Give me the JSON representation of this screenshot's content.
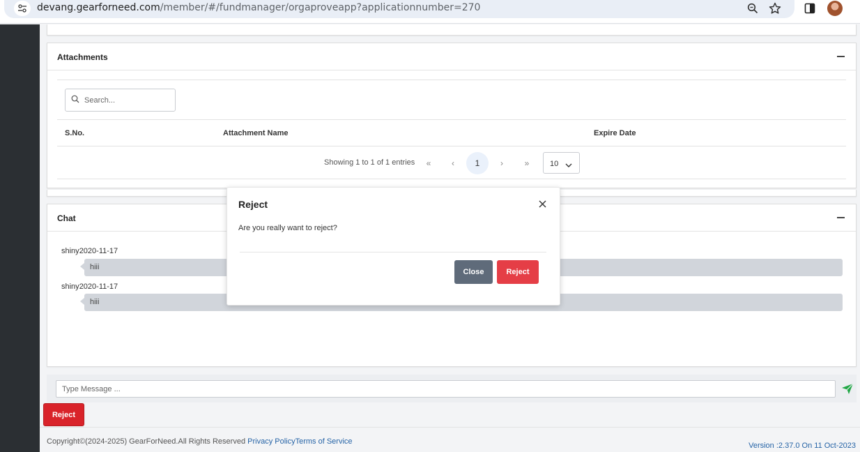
{
  "browser": {
    "url_host": "devang.gearforneed.com",
    "url_path": "/member/#/fundmanager/orgaproveapp?applicationnumber=270"
  },
  "attachments": {
    "title": "Attachments",
    "search_placeholder": "Search...",
    "columns": [
      "S.No.",
      "Attachment Name",
      "Expire Date"
    ],
    "pager_info": "Showing 1 to 1 of 1 entries",
    "pager": {
      "first": "«",
      "prev": "‹",
      "current": "1",
      "next": "›",
      "last": "»"
    },
    "page_size": "10"
  },
  "chat": {
    "title": "Chat",
    "messages": [
      {
        "user": "shiny",
        "date": "2020-11-17",
        "text": "hiii"
      },
      {
        "user": "shiny",
        "date": "2020-11-17",
        "text": "hiii"
      }
    ],
    "input_placeholder": "Type Message ..."
  },
  "actions": {
    "reject_label": "Reject"
  },
  "modal": {
    "title": "Reject",
    "body": "Are you really want to reject?",
    "close_label": "Close",
    "reject_label": "Reject"
  },
  "footer": {
    "copyright": "Copyright©(2024-2025) GearForNeed.All Rights Reserved ",
    "privacy": "Privacy Policy",
    "terms": "Terms of Service",
    "version": "Version :2.37.0 On 11 Oct-2023"
  },
  "colors": {
    "sidebar": "#2b2f33",
    "reject": "#d9232a",
    "modal_reject": "#e53e46",
    "close": "#5f6b7a",
    "link": "#2563a6",
    "send": "#22a846"
  },
  "icons": [
    "site-settings-icon",
    "zoom-icon",
    "bookmark-star-icon",
    "side-panel-icon",
    "search-icon",
    "chevron-down-icon",
    "collapse-icon",
    "close-icon",
    "send-icon"
  ]
}
